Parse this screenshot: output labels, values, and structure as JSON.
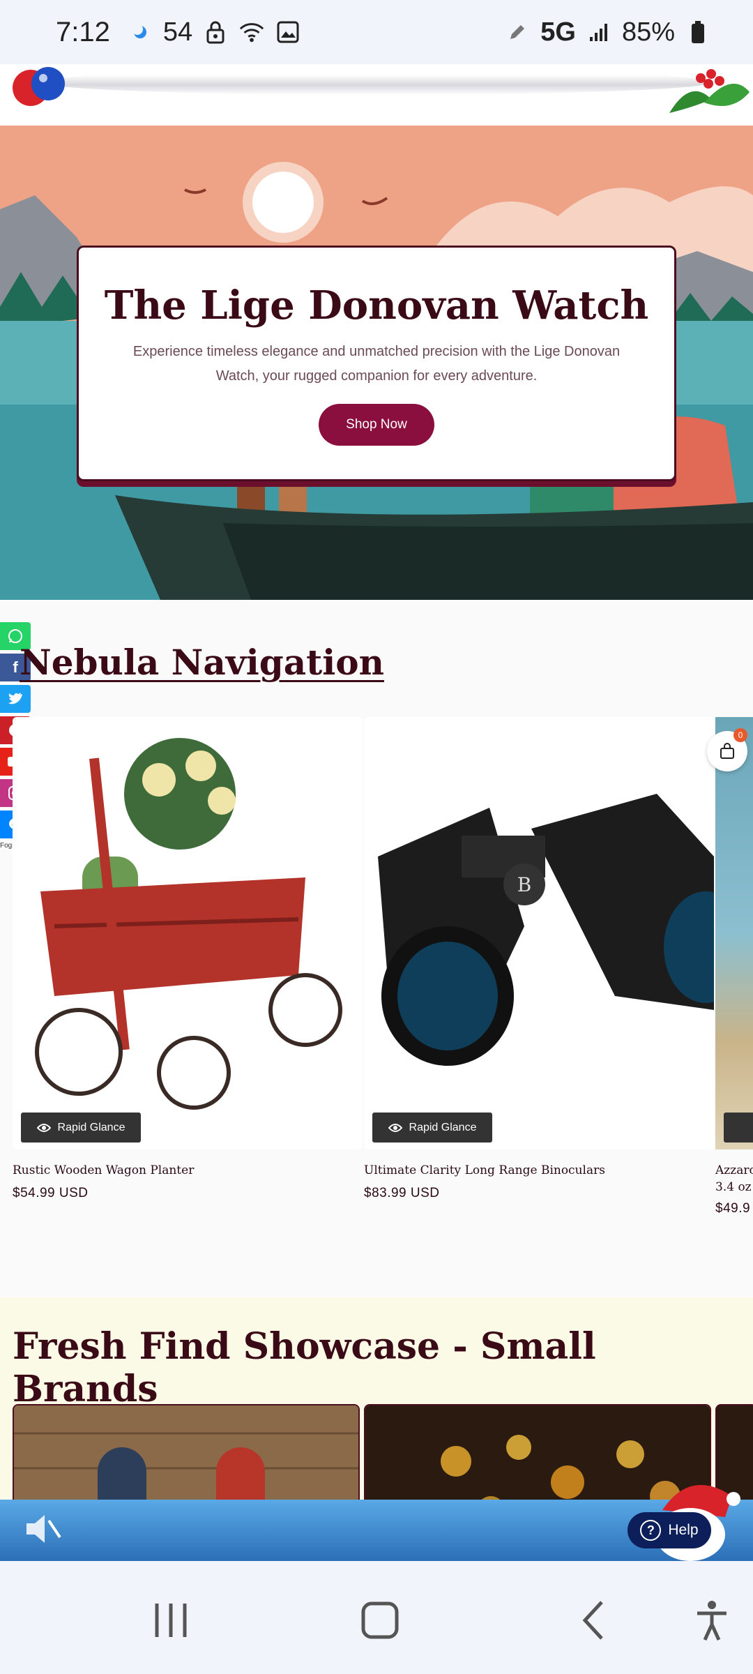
{
  "status_bar": {
    "time": "7:12",
    "notif_count": "54",
    "network": "5G",
    "battery": "85%"
  },
  "hero": {
    "title": "The Lige Donovan Watch",
    "description": "Experience timeless elegance and unmatched precision with the Lige Donovan Watch, your rugged companion for every adventure.",
    "button_label": "Shop Now"
  },
  "share_bar": {
    "items": [
      "whatsapp",
      "facebook",
      "twitter",
      "pinterest",
      "youtube",
      "instagram",
      "messenger"
    ],
    "caption": "Fogprime"
  },
  "section1": {
    "title": "Nebula Navigation",
    "products": [
      {
        "name": "Rustic Wooden Wagon Planter",
        "price": "$54.99 USD",
        "quick_label": "Rapid Glance"
      },
      {
        "name": "Ultimate Clarity Long Range Binoculars",
        "price": "$83.99 USD",
        "quick_label": "Rapid Glance"
      },
      {
        "name": "Azzaro",
        "name_line2": "3.4 oz",
        "price": "$49.9"
      }
    ]
  },
  "cart": {
    "count": "0"
  },
  "section2": {
    "title": "Fresh Find Showcase - Small Brands"
  },
  "help": {
    "label": "Help"
  },
  "colors": {
    "brand": "#8a0f3e",
    "heading": "#3b0a17",
    "help_bg": "#0c1f5a"
  }
}
